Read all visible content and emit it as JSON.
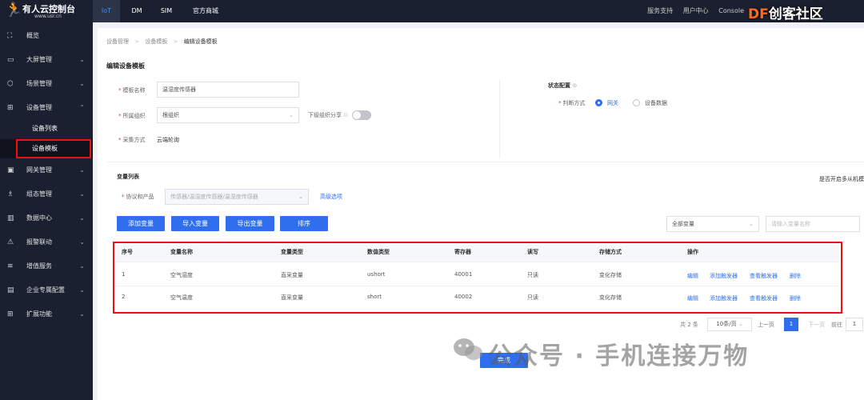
{
  "app": {
    "title": "有人云控制台",
    "subtitle": "www.usr.cn"
  },
  "topnav": {
    "tabs": [
      "IoT",
      "DM",
      "SIM",
      "官方商城"
    ],
    "right": [
      "服务支持",
      "用户中心",
      "Console"
    ]
  },
  "brand": {
    "df_prefix": "DF",
    "df_text": "创客社区"
  },
  "sidebar": {
    "items": [
      {
        "label": "概览",
        "icon": "overview-icon"
      },
      {
        "label": "大屏管理",
        "icon": "screen-icon"
      },
      {
        "label": "场景管理",
        "icon": "scene-icon"
      },
      {
        "label": "设备管理",
        "icon": "device-icon"
      },
      {
        "label": "网关管理",
        "icon": "gateway-icon"
      },
      {
        "label": "组态管理",
        "icon": "config-icon"
      },
      {
        "label": "数据中心",
        "icon": "data-icon"
      },
      {
        "label": "报警联动",
        "icon": "alarm-icon"
      },
      {
        "label": "增值服务",
        "icon": "wifi-icon"
      },
      {
        "label": "企业专属配置",
        "icon": "enterprise-icon"
      },
      {
        "label": "扩展功能",
        "icon": "grid-icon"
      }
    ],
    "subitems": [
      "设备列表",
      "设备模板"
    ]
  },
  "breadcrumb": {
    "b1": "设备管理",
    "b2": "设备模板",
    "b3": "编辑设备模板"
  },
  "page_title": "编辑设备模板",
  "form": {
    "template_name_label": "模板名称",
    "template_name_value": "温湿度传感器",
    "org_label": "所属组织",
    "org_value": "根组织",
    "share_label": "下级组织分享",
    "collect_label": "采集方式",
    "collect_value": "云端轮询"
  },
  "status": {
    "title": "状态配置",
    "judge_label": "判断方式",
    "option1": "网关",
    "option2": "设备数据"
  },
  "variables": {
    "title": "变量列表",
    "multi_slave": "是否开启多从机模",
    "protocol_label": "协议和产品",
    "protocol_value": "传感器/温湿度传感器/温湿度传感器",
    "advanced": "高级选项",
    "buttons": {
      "add": "添加变量",
      "import": "导入变量",
      "export": "导出变量",
      "sort": "排序"
    },
    "filter_value": "全部变量",
    "search_placeholder": "请输入变量名称"
  },
  "table": {
    "headers": [
      "序号",
      "变量名称",
      "变量类型",
      "数值类型",
      "寄存器",
      "读写",
      "存储方式",
      "操作"
    ],
    "rows": [
      {
        "no": "1",
        "name": "空气湿度",
        "var_type": "直采变量",
        "num_type": "ushort",
        "reg": "40001",
        "rw": "只读",
        "store": "变化存储"
      },
      {
        "no": "2",
        "name": "空气温度",
        "var_type": "直采变量",
        "num_type": "short",
        "reg": "40002",
        "rw": "只读",
        "store": "变化存储"
      }
    ],
    "actions": [
      "编辑",
      "添加触发器",
      "查看触发器",
      "删除"
    ]
  },
  "pager": {
    "total": "共 2 条",
    "size": "10条/页",
    "prev": "上一页",
    "page": "1",
    "next": "下一页",
    "goto": "前往",
    "goto_value": "1"
  },
  "finish_button": "完成",
  "watermark": "公众号 · 手机连接万物",
  "colors": {
    "primary": "#2f6fed",
    "sidebar": "#1b2030",
    "highlight": "#e11111"
  }
}
